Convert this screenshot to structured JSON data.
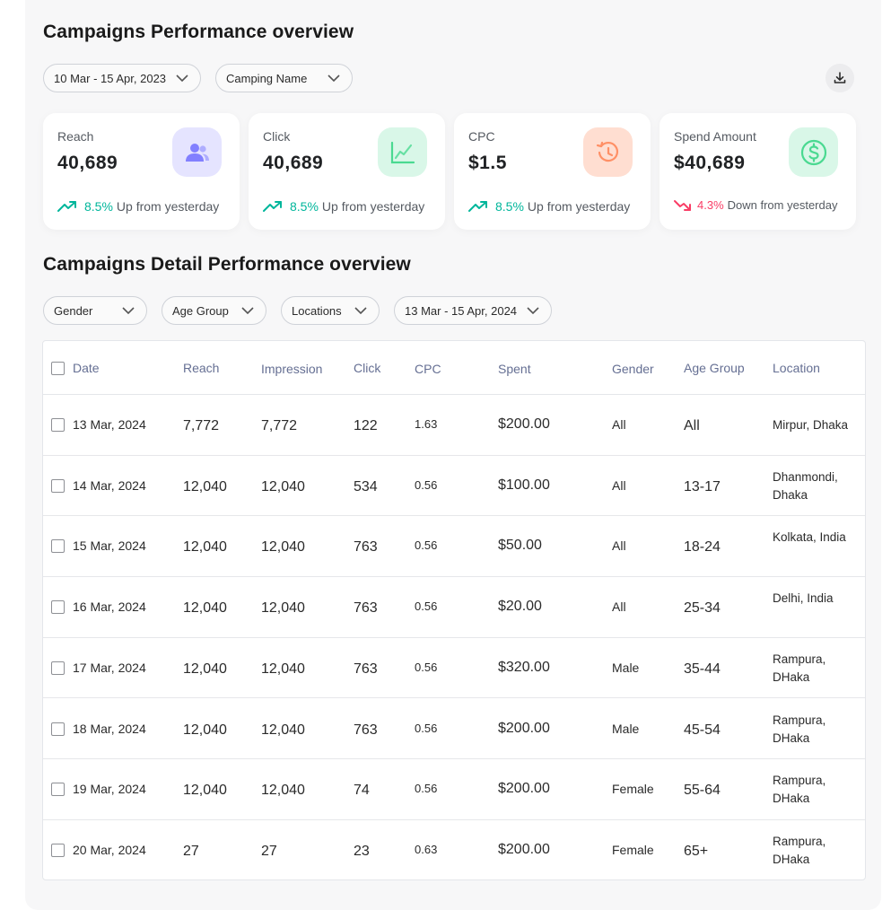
{
  "overview": {
    "title": "Campaigns Performance overview",
    "date_filter": "10 Mar - 15 Apr, 2023",
    "name_filter": "Camping Name",
    "download_icon": "download-icon"
  },
  "cards": [
    {
      "label": "Reach",
      "value": "40,689",
      "icon": "users-icon",
      "icon_bg": "#e5e4ff",
      "icon_color": "#8280ff",
      "trend_dir": "up",
      "trend_pct": "8.5%",
      "trend_text": "Up from yesterday"
    },
    {
      "label": "Click",
      "value": "40,689",
      "icon": "line-chart-icon",
      "icon_bg": "#d9f7e8",
      "icon_color": "#4ad991",
      "trend_dir": "up",
      "trend_pct": "8.5%",
      "trend_text": "Up from yesterday"
    },
    {
      "label": "CPC",
      "value": "$1.5",
      "icon": "history-icon",
      "icon_bg": "#ffded1",
      "icon_color": "#ff9066",
      "trend_dir": "up",
      "trend_pct": "8.5%",
      "trend_text": "Up from yesterday"
    },
    {
      "label": "Spend Amount",
      "value": "$40,689",
      "icon": "dollar-icon",
      "icon_bg": "#d9f7e8",
      "icon_color": "#4ad991",
      "trend_dir": "down",
      "trend_pct": "4.3%",
      "trend_text": "Down from yesterday"
    }
  ],
  "detail": {
    "title": "Campaigns Detail Performance overview",
    "filters": [
      "Gender",
      "Age Group",
      "Locations",
      "13 Mar - 15 Apr, 2024"
    ]
  },
  "table": {
    "columns": [
      "Date",
      "Reach",
      "Impression",
      "Click",
      "CPC",
      "Spent",
      "Gender",
      "Age Group",
      "Location"
    ],
    "rows": [
      {
        "date": "13 Mar, 2024",
        "reach": "7,772",
        "impression": "7,772",
        "click": "122",
        "cpc": "1.63",
        "spent": "$200.00",
        "gender": "All",
        "age": "All",
        "location": "Mirpur, Dhaka"
      },
      {
        "date": "14 Mar, 2024",
        "reach": "12,040",
        "impression": "12,040",
        "click": "534",
        "cpc": "0.56",
        "spent": "$100.00",
        "gender": "All",
        "age": "13-17",
        "location": "Dhanmondi, Dhaka"
      },
      {
        "date": "15 Mar, 2024",
        "reach": "12,040",
        "impression": "12,040",
        "click": "763",
        "cpc": "0.56",
        "spent": "$50.00",
        "gender": "All",
        "age": "18-24",
        "location": "Kolkata, India"
      },
      {
        "date": "16 Mar, 2024",
        "reach": "12,040",
        "impression": "12,040",
        "click": "763",
        "cpc": "0.56",
        "spent": "$20.00",
        "gender": "All",
        "age": "25-34",
        "location": "Delhi, India"
      },
      {
        "date": "17 Mar, 2024",
        "reach": "12,040",
        "impression": "12,040",
        "click": "763",
        "cpc": "0.56",
        "spent": "$320.00",
        "gender": "Male",
        "age": "35-44",
        "location": "Rampura, DHaka"
      },
      {
        "date": "18 Mar, 2024",
        "reach": "12,040",
        "impression": "12,040",
        "click": "763",
        "cpc": "0.56",
        "spent": "$200.00",
        "gender": "Male",
        "age": "45-54",
        "location": "Rampura, DHaka"
      },
      {
        "date": "19 Mar, 2024",
        "reach": "12,040",
        "impression": "12,040",
        "click": "74",
        "cpc": "0.56",
        "spent": "$200.00",
        "gender": "Female",
        "age": "55-64",
        "location": "Rampura, DHaka"
      },
      {
        "date": "20 Mar, 2024",
        "reach": "27",
        "impression": "27",
        "click": "23",
        "cpc": "0.63",
        "spent": "$200.00",
        "gender": "Female",
        "age": "65+",
        "location": "Rampura, DHaka"
      }
    ]
  },
  "colors": {
    "up": "#00b69b",
    "down": "#f93c65",
    "header_text": "#656f93"
  }
}
